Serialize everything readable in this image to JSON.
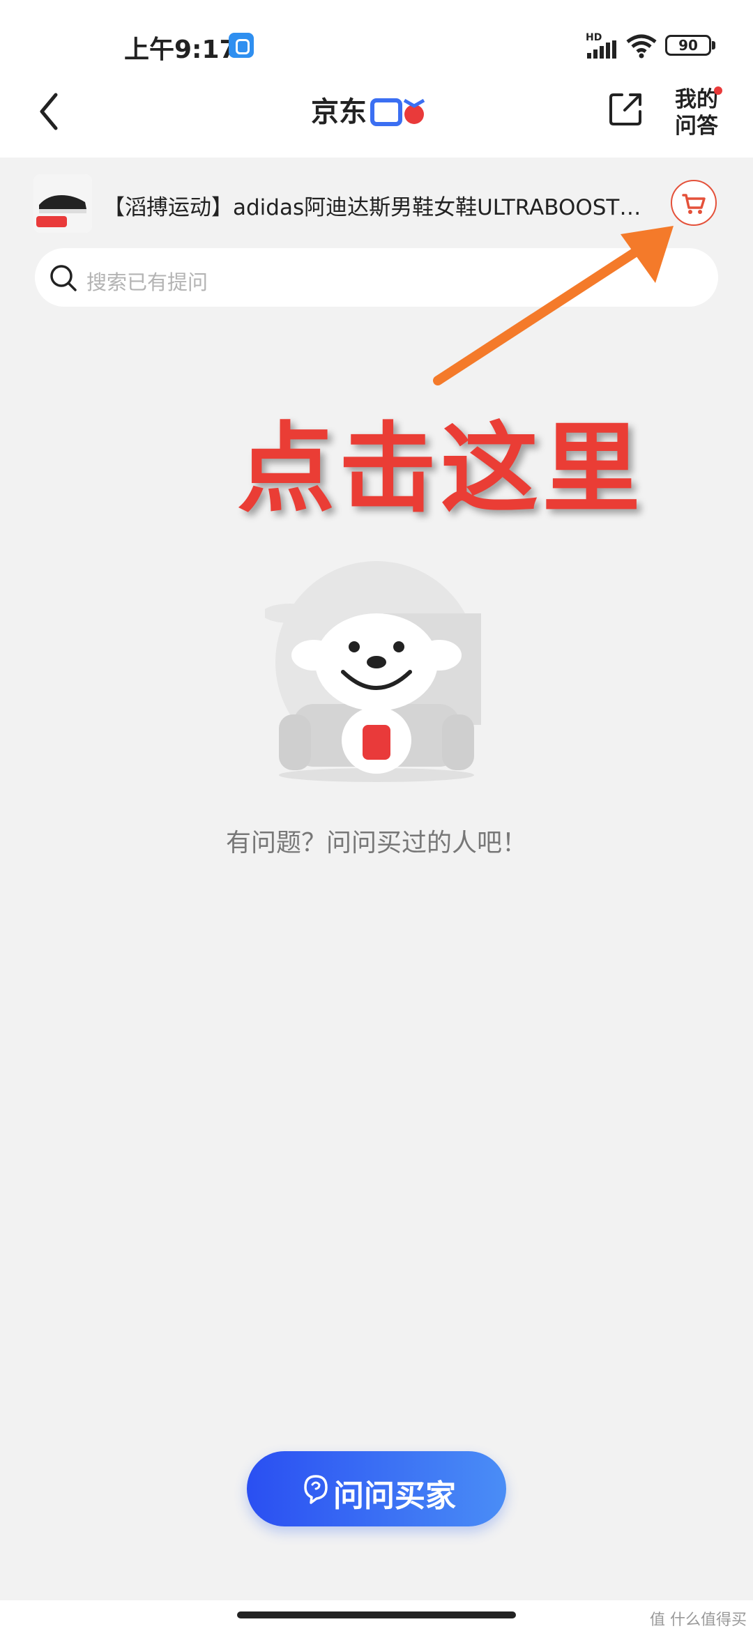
{
  "status_bar": {
    "time": "上午9:17",
    "network_label": "HD",
    "battery": "90"
  },
  "header": {
    "logo_text": "京东问答",
    "my_qa_line1": "我的",
    "my_qa_line2": "问答",
    "icons": [
      "chevron-left-icon",
      "share-icon"
    ]
  },
  "product": {
    "title": "【滔搏运动】adidas阿迪达斯男鞋女鞋ULTRABOOST跑步鞋",
    "cart_icon": "cart-icon"
  },
  "search": {
    "placeholder": "搜索已有提问"
  },
  "annotation": {
    "text": "点击这里",
    "color": "#ea3d35",
    "arrow_color": "#f47a2a"
  },
  "empty_state": {
    "message": "有问题？问问买过的人吧！"
  },
  "ask_button": {
    "label": "问问买家"
  },
  "watermark": "值 什么值得买",
  "colors": {
    "accent_red": "#e4513a",
    "button_blue_start": "#2a4ff2",
    "button_blue_end": "#4a8df6"
  }
}
